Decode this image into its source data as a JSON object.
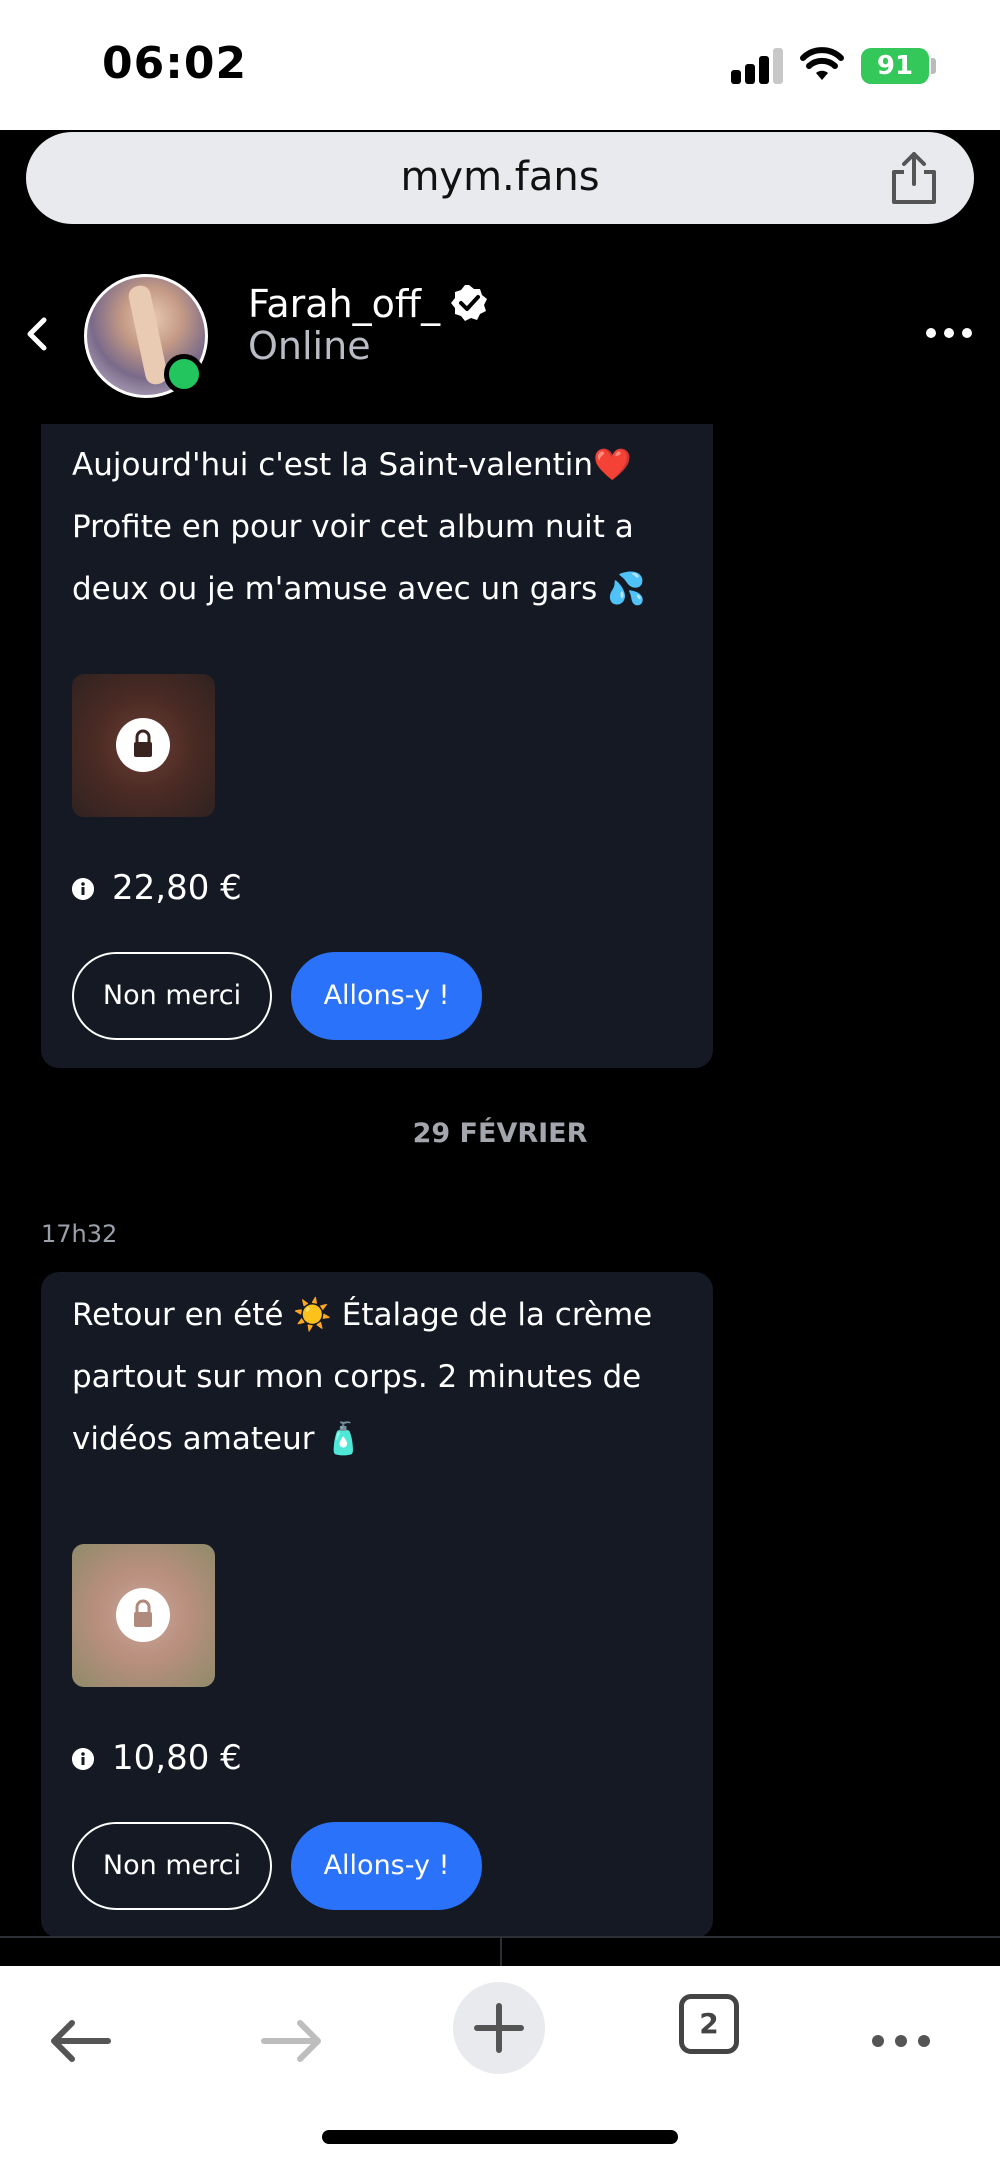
{
  "status_bar": {
    "time": "06:02",
    "battery": "91"
  },
  "browser": {
    "url": "mym.fans",
    "tab_count": "2"
  },
  "chat_header": {
    "name": "Farah_off_",
    "status": "Online"
  },
  "messages": [
    {
      "text": "Aujourd'hui c'est la Saint-valentin❤️ Profite en pour voir cet album nuit a deux ou je m'amuse avec un gars 💦",
      "price": "22,80 €",
      "decline_label": "Non merci",
      "accept_label": "Allons-y !"
    },
    {
      "date_separator": "29 FÉVRIER",
      "time": "17h32",
      "text": "Retour en été ☀️ Étalage de la crème partout sur mon corps. 2 minutes de vidéos amateur 🧴",
      "price": "10,80 €",
      "decline_label": "Non merci",
      "accept_label": "Allons-y !"
    }
  ],
  "colors": {
    "accent": "#2b72fb",
    "online": "#22c55e",
    "card": "#141923",
    "battery": "#34c759"
  },
  "icons": [
    "back-icon",
    "verified-icon",
    "more-icon",
    "lock-icon",
    "info-icon",
    "share-icon",
    "arrow-left-icon",
    "arrow-right-icon",
    "plus-icon"
  ]
}
